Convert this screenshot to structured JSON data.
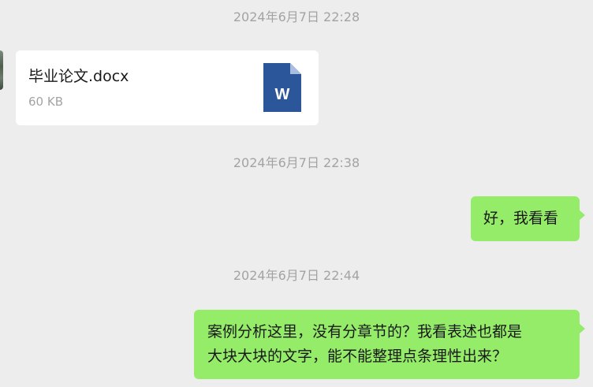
{
  "timestamps": [
    "2024年6月7日 22:28",
    "2024年6月7日 22:38",
    "2024年6月7日 22:44"
  ],
  "file_message": {
    "file_name": "毕业论文.docx",
    "file_size": "60 KB",
    "icon": "word-document-icon",
    "icon_letter": "W",
    "icon_color": "#2b579a"
  },
  "messages": [
    {
      "line1": "好，我看看"
    },
    {
      "line1": "案例分析这里，没有分章节的？我看表述也都是",
      "line2": "大块大块的文字，能不能整理点条理性出来？"
    }
  ],
  "colors": {
    "background": "#ededed",
    "outgoing_bubble": "#95ec69",
    "incoming_bubble": "#ffffff",
    "timestamp_text": "#a3a3a3"
  }
}
